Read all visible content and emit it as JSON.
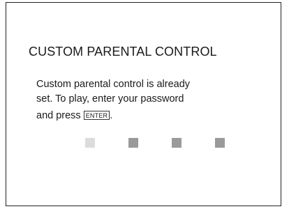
{
  "dialog": {
    "title": "CUSTOM PARENTAL CONTROL",
    "message_line1": "Custom parental control is already",
    "message_line2": "set. To play, enter your password",
    "message_line3_prefix": "and press ",
    "enter_key_label": "ENTER",
    "message_line3_suffix": "."
  },
  "password": {
    "digits_total": 4,
    "active_index": 0,
    "colors": {
      "active": "#dcdcdc",
      "inactive": "#9a9a9a"
    }
  }
}
